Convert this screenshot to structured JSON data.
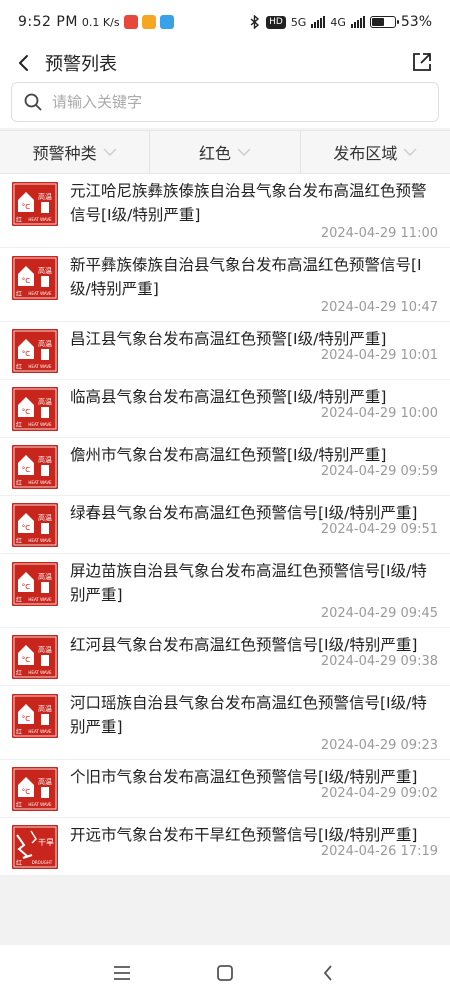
{
  "status_bar": {
    "time": "9:52 PM",
    "speed": "0.1 K/s",
    "hd_label": "HD",
    "net1": "5G",
    "net2": "4G",
    "battery_percent": 53,
    "battery_text": "53%"
  },
  "header": {
    "title": "预警列表"
  },
  "search": {
    "placeholder": "请输入关键字",
    "value": ""
  },
  "filters": [
    {
      "label": "预警种类"
    },
    {
      "label": "红色"
    },
    {
      "label": "发布区域"
    }
  ],
  "icons": {
    "heat_badge": "高温",
    "heat_en": "HEAT WAVE",
    "drought_badge": "干旱",
    "drought_en": "DROUGHT",
    "level": "红",
    "unit": "°C"
  },
  "items": [
    {
      "icon": "heat",
      "title": "元江哈尼族彝族傣族自治县气象台发布高温红色预警信号[I级/特别严重]",
      "time": "2024-04-29 11:00"
    },
    {
      "icon": "heat",
      "title": "新平彝族傣族自治县气象台发布高温红色预警信号[I级/特别严重]",
      "time": "2024-04-29 10:47"
    },
    {
      "icon": "heat",
      "title": "昌江县气象台发布高温红色预警[I级/特别严重]",
      "time": "2024-04-29 10:01"
    },
    {
      "icon": "heat",
      "title": "临高县气象台发布高温红色预警[I级/特别严重]",
      "time": "2024-04-29 10:00"
    },
    {
      "icon": "heat",
      "title": "儋州市气象台发布高温红色预警[I级/特别严重]",
      "time": "2024-04-29 09:59"
    },
    {
      "icon": "heat",
      "title": "绿春县气象台发布高温红色预警信号[I级/特别严重]",
      "time": "2024-04-29 09:51"
    },
    {
      "icon": "heat",
      "title": "屏边苗族自治县气象台发布高温红色预警信号[I级/特别严重]",
      "time": "2024-04-29 09:45"
    },
    {
      "icon": "heat",
      "title": "红河县气象台发布高温红色预警信号[I级/特别严重]",
      "time": "2024-04-29 09:38"
    },
    {
      "icon": "heat",
      "title": "河口瑶族自治县气象台发布高温红色预警信号[I级/特别严重]",
      "time": "2024-04-29 09:23"
    },
    {
      "icon": "heat",
      "title": "个旧市气象台发布高温红色预警信号[I级/特别严重]",
      "time": "2024-04-29 09:02"
    },
    {
      "icon": "drought",
      "title": "开远市气象台发布干旱红色预警信号[I级/特别严重]",
      "time": "2024-04-26 17:19"
    }
  ],
  "colors": {
    "warning_red": "#c8251d",
    "text_primary": "#222222",
    "text_secondary": "#9a9a9a"
  }
}
